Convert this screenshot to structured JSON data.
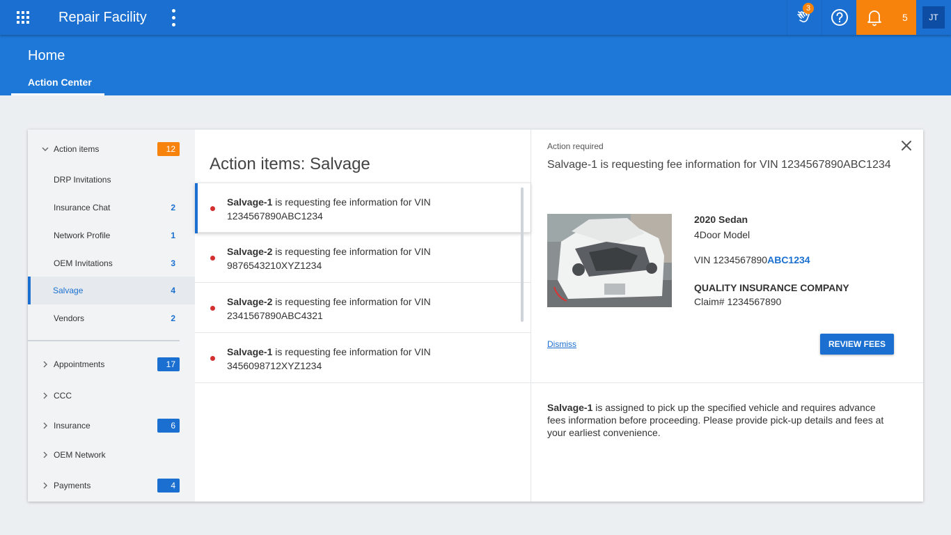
{
  "topbar": {
    "app_title": "Repair Facility",
    "flag_badge": "3",
    "notif_count": "5",
    "avatar": "JT",
    "icons": [
      "apps-grid-icon",
      "more-vert-icon",
      "hand-wave-icon",
      "help-icon",
      "bell-icon"
    ]
  },
  "header": {
    "title": "Home",
    "tab": "Action Center"
  },
  "sidebar": {
    "action_items": {
      "label": "Action items",
      "count": "12"
    },
    "sub_items": [
      {
        "label": "DRP Invitations",
        "count": ""
      },
      {
        "label": "Insurance Chat",
        "count": "2"
      },
      {
        "label": "Network Profile",
        "count": "1"
      },
      {
        "label": "OEM Invitations",
        "count": "3"
      },
      {
        "label": "Salvage",
        "count": "4"
      },
      {
        "label": "Vendors",
        "count": "2"
      }
    ],
    "groups": [
      {
        "label": "Appointments",
        "count": "17"
      },
      {
        "label": "CCC",
        "count": ""
      },
      {
        "label": "Insurance",
        "count": "6"
      },
      {
        "label": "OEM Network",
        "count": ""
      },
      {
        "label": "Payments",
        "count": "4"
      }
    ]
  },
  "list": {
    "title": "Action items: Salvage",
    "items": [
      {
        "sender": "Salvage-1",
        "text": " is requesting fee information for VIN",
        "vin": "1234567890ABC1234"
      },
      {
        "sender": "Salvage-2",
        "text": " is requesting fee information for VIN",
        "vin": "9876543210XYZ1234"
      },
      {
        "sender": "Salvage-2",
        "text": " is requesting fee information for VIN",
        "vin": "2341567890ABC4321"
      },
      {
        "sender": "Salvage-1",
        "text": " is requesting fee information for VIN",
        "vin": "3456098712XYZ1234"
      }
    ]
  },
  "detail": {
    "label": "Action required",
    "title": "Salvage-1 is requesting fee information for VIN 1234567890ABC1234",
    "vehicle": "2020 Sedan",
    "model": "4Door Model",
    "vin_prefix": "VIN 1234567890",
    "vin_highlight": "ABC1234",
    "insurer": "QUALITY INSURANCE COMPANY",
    "claim": "Claim# 1234567890",
    "dismiss": "Dismiss",
    "review_button": "REVIEW FEES",
    "desc_sender": "Salvage-1",
    "desc_text": " is assigned to pick up the specified vehicle and requires advance fees information before proceeding. Please provide pick-up details and fees at your earliest convenience."
  },
  "colors": {
    "primary": "#1a6fd0",
    "header_band": "#1e78d8",
    "accent_orange": "#f7820c",
    "unread_dot": "#d32f2f"
  }
}
